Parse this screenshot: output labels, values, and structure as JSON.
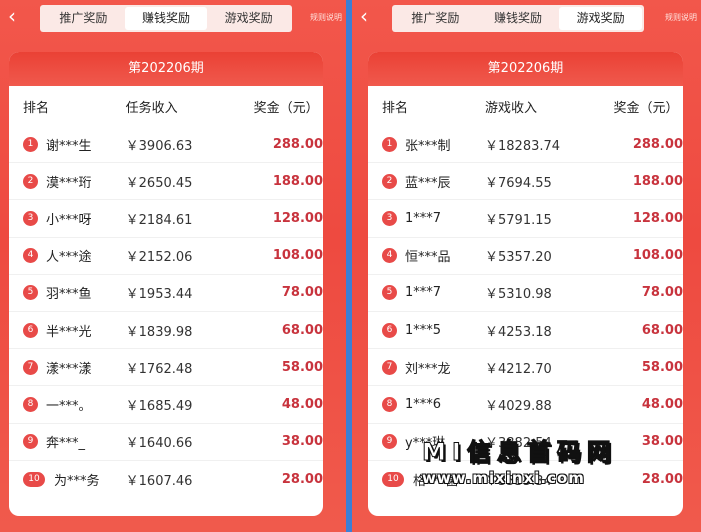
{
  "left": {
    "tabs": [
      "推广奖励",
      "赚钱奖励",
      "游戏奖励"
    ],
    "active_tab": 1,
    "rules_link": "规则说明",
    "period": "第202206期",
    "columns": [
      "排名",
      "任务收入",
      "奖金（元）"
    ],
    "rows": [
      {
        "rank": "1",
        "name": "谢***生",
        "income": "￥3906.63",
        "prize": "288.00"
      },
      {
        "rank": "2",
        "name": "漠***珩",
        "income": "￥2650.45",
        "prize": "188.00"
      },
      {
        "rank": "3",
        "name": "小***呀",
        "income": "￥2184.61",
        "prize": "128.00"
      },
      {
        "rank": "4",
        "name": "人***途",
        "income": "￥2152.06",
        "prize": "108.00"
      },
      {
        "rank": "5",
        "name": "羽***鱼",
        "income": "￥1953.44",
        "prize": "78.00"
      },
      {
        "rank": "6",
        "name": "半***光",
        "income": "￥1839.98",
        "prize": "68.00"
      },
      {
        "rank": "7",
        "name": "漾***漾",
        "income": "￥1762.48",
        "prize": "58.00"
      },
      {
        "rank": "8",
        "name": "一***。",
        "income": "￥1685.49",
        "prize": "48.00"
      },
      {
        "rank": "9",
        "name": "奔***_",
        "income": "￥1640.66",
        "prize": "38.00"
      },
      {
        "rank": "10",
        "name": "为***务",
        "income": "￥1607.46",
        "prize": "28.00"
      }
    ]
  },
  "right": {
    "tabs": [
      "推广奖励",
      "赚钱奖励",
      "游戏奖励"
    ],
    "active_tab": 2,
    "rules_link": "规则说明",
    "period": "第202206期",
    "columns": [
      "排名",
      "游戏收入",
      "奖金（元）"
    ],
    "rows": [
      {
        "rank": "1",
        "name": "张***制",
        "income": "￥18283.74",
        "prize": "288.00"
      },
      {
        "rank": "2",
        "name": "蓝***辰",
        "income": "￥7694.55",
        "prize": "188.00"
      },
      {
        "rank": "3",
        "name": "1***7",
        "income": "￥5791.15",
        "prize": "128.00"
      },
      {
        "rank": "4",
        "name": "恒***品",
        "income": "￥5357.20",
        "prize": "108.00"
      },
      {
        "rank": "5",
        "name": "1***7",
        "income": "￥5310.98",
        "prize": "78.00"
      },
      {
        "rank": "6",
        "name": "1***5",
        "income": "￥4253.18",
        "prize": "68.00"
      },
      {
        "rank": "7",
        "name": "刘***龙",
        "income": "￥4212.70",
        "prize": "58.00"
      },
      {
        "rank": "8",
        "name": "1***6",
        "income": "￥4029.88",
        "prize": "48.00"
      },
      {
        "rank": "9",
        "name": "y***琳",
        "income": "￥3882.54",
        "prize": "38.00"
      },
      {
        "rank": "10",
        "name": "格***菌",
        "income": "￥3535.34",
        "prize": "28.00"
      }
    ]
  },
  "watermark": {
    "line1": "MI信息首码网",
    "line2": "www.mixinxi.com"
  },
  "colors": {
    "background": "#f04d43",
    "prize": "#c8333d",
    "badge": "#e84a48"
  }
}
